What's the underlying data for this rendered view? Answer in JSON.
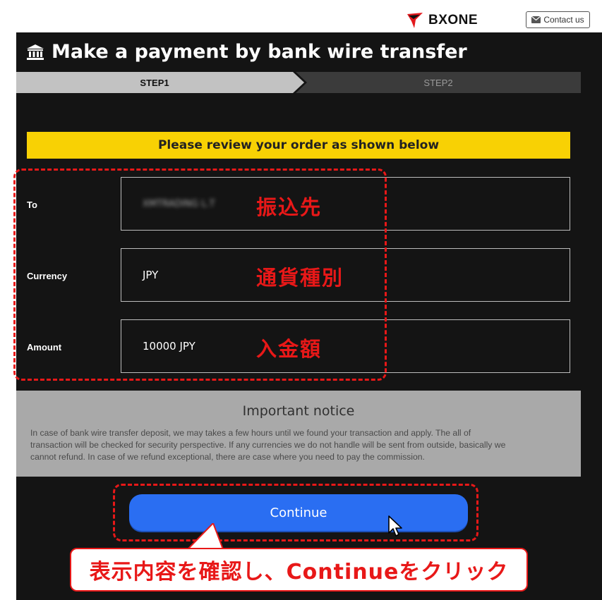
{
  "header": {
    "brand": "BXONE",
    "contact_label": "Contact us"
  },
  "page": {
    "title": "Make a payment by bank wire transfer"
  },
  "steps": [
    {
      "label": "STEP1",
      "active": true
    },
    {
      "label": "STEP2",
      "active": false
    }
  ],
  "review": {
    "banner": "Please review your order as shown below",
    "rows": [
      {
        "label": "To",
        "value": "XMTRADING L.T",
        "annotation": "振込先"
      },
      {
        "label": "Currency",
        "value": "JPY",
        "annotation": "通貨種別"
      },
      {
        "label": "Amount",
        "value": "10000 JPY",
        "annotation": "入金額"
      }
    ]
  },
  "notice": {
    "title": "Important notice",
    "lines": [
      "In case of bank wire transfer deposit, we may takes a few hours until we found your transaction and apply. The all of",
      "transaction will be checked for security perspective. If any currencies we do not handle will be sent from outside, basically we",
      "cannot refund. In case of we refund exceptional, there are case where you need to pay the commission."
    ]
  },
  "actions": {
    "continue_label": "Continue"
  },
  "callout": {
    "text": "表示内容を確認し、Continueをクリック"
  },
  "colors": {
    "panel_bg": "#141414",
    "banner_yellow": "#f8d104",
    "button_blue": "#2a6ef2",
    "annotation_red": "#e81818",
    "notice_gray": "#a9a9a9"
  },
  "icons": {
    "title": "bank-icon",
    "contact": "envelope-icon",
    "brand": "bxone-logo-mark"
  }
}
